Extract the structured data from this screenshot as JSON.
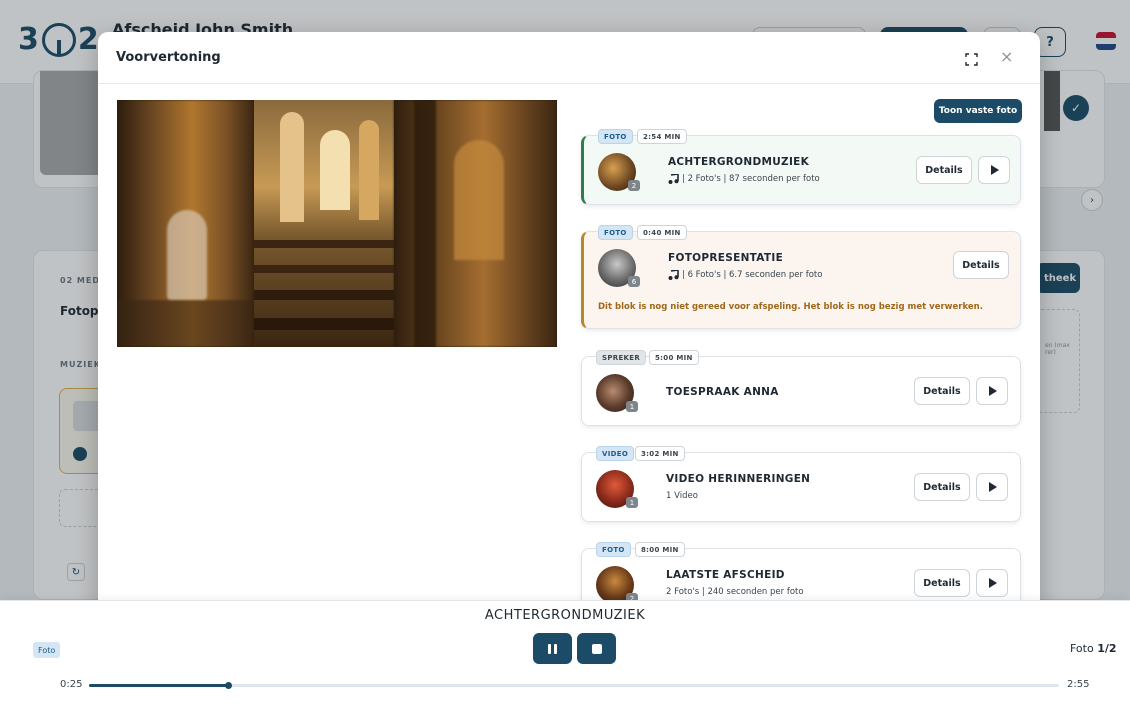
{
  "app": {
    "title": "Afscheid John Smith",
    "help_label": "?",
    "bg_section_label": "02 MED",
    "bg_section_title": "Fotopre",
    "bg_music_label": "MUZIEK",
    "bg_library_label": "theek",
    "bg_hint_text": "en (max\nrer)"
  },
  "modal": {
    "title": "Voorvertoning",
    "toon_button": "Toon vaste foto",
    "blocks": [
      {
        "type": "FOTO",
        "duration": "2:54 MIN",
        "title": "ACHTERGRONDMUZIEK",
        "meta": "| 2 Foto's | 87 seconden per foto",
        "has_music_icon": true,
        "count": "2",
        "details": "Details",
        "has_play": true,
        "state": "active"
      },
      {
        "type": "FOTO",
        "duration": "0:40 MIN",
        "title": "FOTOPRESENTATIE",
        "meta": "| 6 Foto's | 6.7 seconden per foto",
        "has_music_icon": true,
        "count": "6",
        "details": "Details",
        "has_play": false,
        "state": "warning",
        "warning": "Dit blok is nog niet gereed voor afspeling. Het blok is nog bezig met verwerken."
      },
      {
        "type": "SPREKER",
        "duration": "5:00 MIN",
        "title": "TOESPRAAK ANNA",
        "meta": "",
        "count": "1",
        "details": "Details",
        "has_play": true,
        "state": "normal"
      },
      {
        "type": "VIDEO",
        "duration": "3:02 MIN",
        "title": "VIDEO HERINNERINGEN",
        "meta": "1 Video",
        "count": "1",
        "details": "Details",
        "has_play": true,
        "state": "normal"
      },
      {
        "type": "FOTO",
        "duration": "8:00 MIN",
        "title": "LAATSTE AFSCHEID",
        "meta": "2 Foto's | 240 seconden per foto",
        "count": "2",
        "details": "Details",
        "has_play": true,
        "state": "normal"
      }
    ]
  },
  "player": {
    "title": "ACHTERGRONDMUZIEK",
    "type_chip": "Foto",
    "count_prefix": "Foto ",
    "count_value": "1/2",
    "time_current": "0:25",
    "time_total": "2:55",
    "progress": 0.143
  },
  "colors": {
    "primary": "#1b4b66",
    "active_border": "#2e7d4f",
    "warning_border": "#b8862b",
    "warning_text": "#a0691a",
    "chip_blue": "#d4e6f5"
  }
}
